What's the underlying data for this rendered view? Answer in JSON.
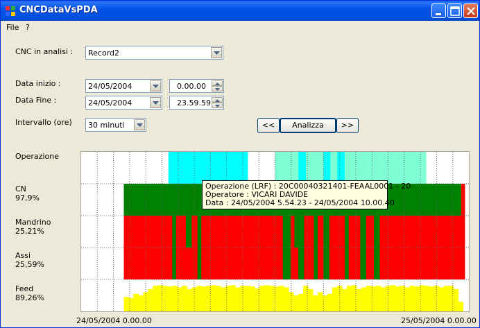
{
  "window": {
    "title": "CNCDataVsPDA"
  },
  "menu": {
    "file": "File",
    "help": "?"
  },
  "form": {
    "cnc_label": "CNC in analisi :",
    "cnc_value": "Record2",
    "data_inizio_label": "Data inizio :",
    "data_inizio_date": "24/05/2004",
    "data_inizio_time": "0.00.00",
    "data_fine_label": "Data Fine :",
    "data_fine_date": "24/05/2004",
    "data_fine_time": "23.59.59",
    "intervallo_label": "Intervallo (ore)",
    "intervallo_value": "30 minuti",
    "prev_label": "<<",
    "analizza_label": "Analizza",
    "next_label": ">>"
  },
  "rows": {
    "operazione": "Operazione",
    "cn": "CN",
    "cn_pct": "97,9%",
    "mandrino": "Mandrino",
    "mandrino_pct": "25,21%",
    "assi": "Assi",
    "assi_pct": "25,59%",
    "feed": "Feed",
    "feed_pct": "89,26%"
  },
  "axis": {
    "start": "24/05/2004 0.00.00",
    "end": "25/05/2004 0.00.00"
  },
  "tooltip": {
    "line1": "Operazione (LRF) : 20C00040321401-FEAAL0001 - 20",
    "line2": "Operatore : VICARI DAVIDE",
    "line3": "Data : 24/05/2004 5.54.23 - 24/05/2004 10.00.40"
  },
  "colors": {
    "cyan": "#00ffff",
    "aquamarine": "#7fffd4",
    "green": "#008000",
    "red": "#ff0000",
    "yellow": "#ffff00"
  },
  "chart_data": {
    "type": "timeline",
    "x_range": [
      "24/05/2004 0.00.00",
      "25/05/2004 0.00.00"
    ],
    "operazione": [
      {
        "from": 0.225,
        "to": 0.43,
        "color": "cyan"
      },
      {
        "from": 0.5,
        "to": 0.56,
        "color": "aquamarine"
      },
      {
        "from": 0.56,
        "to": 0.58,
        "color": "cyan"
      },
      {
        "from": 0.58,
        "to": 0.625,
        "color": "aquamarine"
      },
      {
        "from": 0.625,
        "to": 0.643,
        "color": "cyan"
      },
      {
        "from": 0.643,
        "to": 0.66,
        "color": "aquamarine"
      },
      {
        "from": 0.66,
        "to": 0.68,
        "color": "cyan"
      },
      {
        "from": 0.68,
        "to": 0.89,
        "color": "aquamarine"
      }
    ],
    "cn": [
      {
        "from": 0.11,
        "to": 0.98,
        "color": "green"
      },
      {
        "from": 0.98,
        "to": 0.99,
        "color": "red"
      }
    ],
    "mandrino": [
      {
        "from": 0.11,
        "to": 0.99,
        "color": "red"
      },
      {
        "from": 0.235,
        "to": 0.245,
        "color": "green"
      },
      {
        "from": 0.27,
        "to": 0.285,
        "color": "green"
      },
      {
        "from": 0.3,
        "to": 0.31,
        "color": "green"
      },
      {
        "from": 0.52,
        "to": 0.54,
        "color": "green"
      },
      {
        "from": 0.55,
        "to": 0.575,
        "color": "green"
      },
      {
        "from": 0.6,
        "to": 0.61,
        "color": "green"
      },
      {
        "from": 0.625,
        "to": 0.64,
        "color": "green"
      },
      {
        "from": 0.68,
        "to": 0.69,
        "color": "green"
      },
      {
        "from": 0.72,
        "to": 0.735,
        "color": "green"
      },
      {
        "from": 0.755,
        "to": 0.77,
        "color": "green"
      }
    ],
    "assi": [
      {
        "from": 0.11,
        "to": 0.99,
        "color": "red"
      },
      {
        "from": 0.235,
        "to": 0.245,
        "color": "green"
      },
      {
        "from": 0.3,
        "to": 0.31,
        "color": "green"
      },
      {
        "from": 0.52,
        "to": 0.54,
        "color": "green"
      },
      {
        "from": 0.56,
        "to": 0.575,
        "color": "green"
      },
      {
        "from": 0.6,
        "to": 0.61,
        "color": "green"
      },
      {
        "from": 0.625,
        "to": 0.64,
        "color": "green"
      },
      {
        "from": 0.68,
        "to": 0.69,
        "color": "green"
      },
      {
        "from": 0.72,
        "to": 0.735,
        "color": "green"
      },
      {
        "from": 0.755,
        "to": 0.77,
        "color": "green"
      }
    ],
    "feed_start": 0.11,
    "feed_step": 0.0125,
    "feed": [
      0.45,
      0.42,
      0.55,
      0.5,
      0.6,
      0.7,
      0.8,
      0.82,
      0.8,
      0.78,
      0.8,
      0.75,
      0.8,
      0.7,
      0.75,
      0.8,
      0.78,
      0.8,
      0.82,
      0.8,
      0.75,
      0.8,
      0.82,
      0.75,
      0.8,
      0.8,
      0.78,
      0.72,
      0.8,
      0.82,
      0.8,
      0.78,
      0.8,
      0.75,
      0.6,
      0.5,
      0.55,
      0.8,
      0.7,
      0.5,
      0.6,
      0.5,
      0.55,
      0.75,
      0.8,
      0.7,
      0.8,
      0.82,
      0.7,
      0.75,
      0.8,
      0.78,
      0.8,
      0.75,
      0.8,
      0.82,
      0.78,
      0.8,
      0.75,
      0.8,
      0.78,
      0.82,
      0.8,
      0.78,
      0.8,
      0.75,
      0.8,
      0.8,
      0.7,
      0.3
    ]
  }
}
